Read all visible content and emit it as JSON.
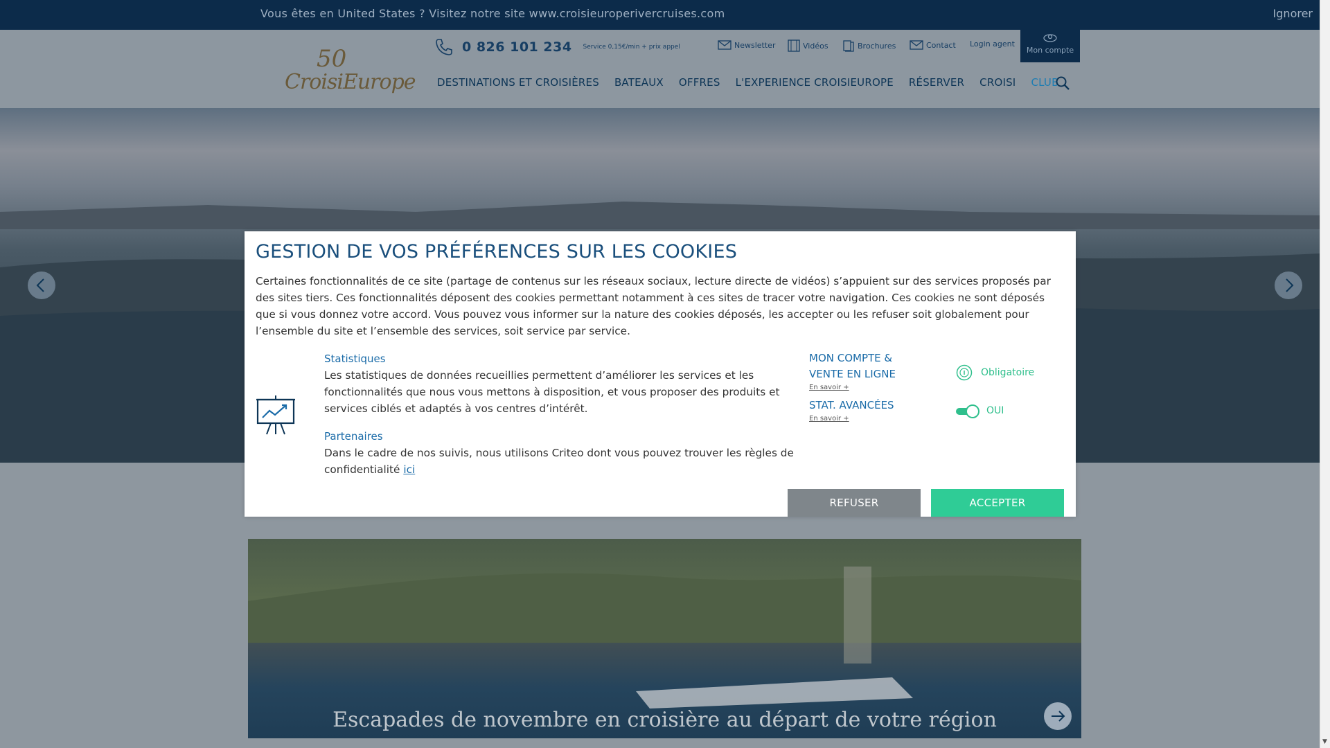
{
  "banner": {
    "message": "Vous êtes en United States ?  Visitez notre site www.croisieuroperivercruises.com",
    "ignore_label": "Ignorer"
  },
  "header": {
    "logo_fifty": "50",
    "logo_text": "CroisiEurope",
    "phone": "0 826 101 234",
    "phone_note": "Service 0,15€/min + prix appel",
    "utility_links": [
      "Newsletter",
      "Vidéos",
      "Brochures",
      "Contact",
      "Login agent"
    ],
    "account_label": "Mon compte",
    "nav": [
      "DESTINATIONS ET CROISIÈRES",
      "BATEAUX",
      "OFFRES",
      "L'EXPERIENCE CROISIEUROPE",
      "RÉSERVER"
    ],
    "nav_club_prefix": "CROISI",
    "nav_club_suffix": "CLUB"
  },
  "promo": {
    "title": "Escapades de novembre en croisière au départ de votre région"
  },
  "cookie_modal": {
    "title": "GESTION DE VOS PRÉFÉRENCES SUR LES COOKIES",
    "intro": "Certaines fonctionnalités de ce site (partage de contenus sur les réseaux sociaux, lecture directe de vidéos) s’appuient sur des services proposés par des sites tiers. Ces fonctionnalités déposent des cookies permettant notamment à ces sites de tracer votre navigation. Ces cookies ne sont déposés que si vous donnez votre accord. Vous pouvez vous informer sur la nature des cookies déposés, les accepter ou les refuser soit globalement pour l’ensemble du site et l’ensemble des services, soit service par service.",
    "stats_heading": "Statistiques",
    "stats_text": "Les statistiques de données recueillies permettent d’améliorer les services et les fonctionnalités que nous vous mettons à disposition, et vous proposer des produits et services ciblés et adaptés à vos centres d’intérêt.",
    "partners_heading": "Partenaires",
    "partners_text": "Dans le cadre de nos suivis, nous utilisons Criteo dont vous pouvez trouver les règles de confidentialité",
    "partners_link": "ici",
    "services": [
      {
        "name": "MON COMPTE & VENTE EN LIGNE",
        "more": "En savoir +",
        "status": "Obligatoire"
      },
      {
        "name": "STAT. AVANCÉES",
        "more": "En savoir +",
        "status": "OUI"
      }
    ],
    "refuse_label": "REFUSER",
    "accept_label": "ACCEPTER"
  },
  "colors": {
    "brand_blue": "#1a4f7c",
    "accent_green": "#2fcc96",
    "refuse_gray": "#7f868b"
  }
}
